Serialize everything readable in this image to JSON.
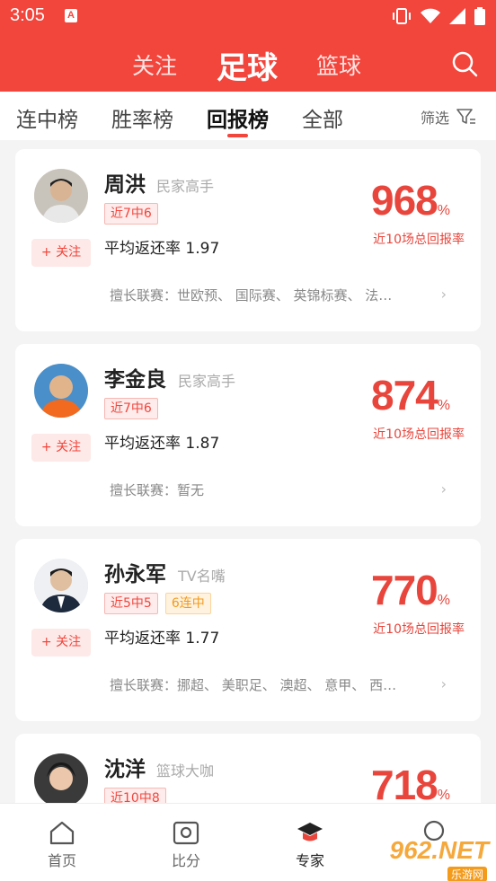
{
  "status": {
    "time": "3:05",
    "app_badge": "A"
  },
  "header": {
    "tabs": [
      {
        "label": "关注"
      },
      {
        "label": "足球"
      },
      {
        "label": "篮球"
      }
    ]
  },
  "subtabs": {
    "items": [
      {
        "label": "连中榜"
      },
      {
        "label": "胜率榜"
      },
      {
        "label": "回报榜"
      },
      {
        "label": "全部"
      }
    ],
    "filter_label": "筛选"
  },
  "cards": [
    {
      "name": "周洪",
      "title": "民家高手",
      "badges": [
        "近7中6"
      ],
      "avg": "平均返还率 1.97",
      "percent": "968",
      "percent_unit": "%",
      "percent_label": "近10场总回报率",
      "leagues": "擅长联赛：世欧预、 国际赛、 英锦标赛、 法…",
      "follow": "+ 关注"
    },
    {
      "name": "李金良",
      "title": "民家高手",
      "badges": [
        "近7中6"
      ],
      "avg": "平均返还率 1.87",
      "percent": "874",
      "percent_unit": "%",
      "percent_label": "近10场总回报率",
      "leagues": "擅长联赛：暂无",
      "follow": "+ 关注"
    },
    {
      "name": "孙永军",
      "title": "TV名嘴",
      "badges": [
        "近5中5",
        "6连中"
      ],
      "avg": "平均返还率 1.77",
      "percent": "770",
      "percent_unit": "%",
      "percent_label": "近10场总回报率",
      "leagues": "擅长联赛：挪超、 美职足、 澳超、 意甲、 西…",
      "follow": "+ 关注"
    },
    {
      "name": "沈洋",
      "title": "篮球大咖",
      "badges": [
        "近10中8"
      ],
      "avg": "",
      "percent": "718",
      "percent_unit": "%",
      "percent_label": "",
      "leagues": "",
      "follow": ""
    }
  ],
  "bottom_nav": [
    {
      "label": "首页"
    },
    {
      "label": "比分"
    },
    {
      "label": "专家"
    },
    {
      "label": ""
    }
  ],
  "watermark": {
    "text": "962.NET",
    "sub": "乐游网"
  },
  "colors": {
    "brand": "#f2453c",
    "accent_orange": "#f39a1b"
  }
}
